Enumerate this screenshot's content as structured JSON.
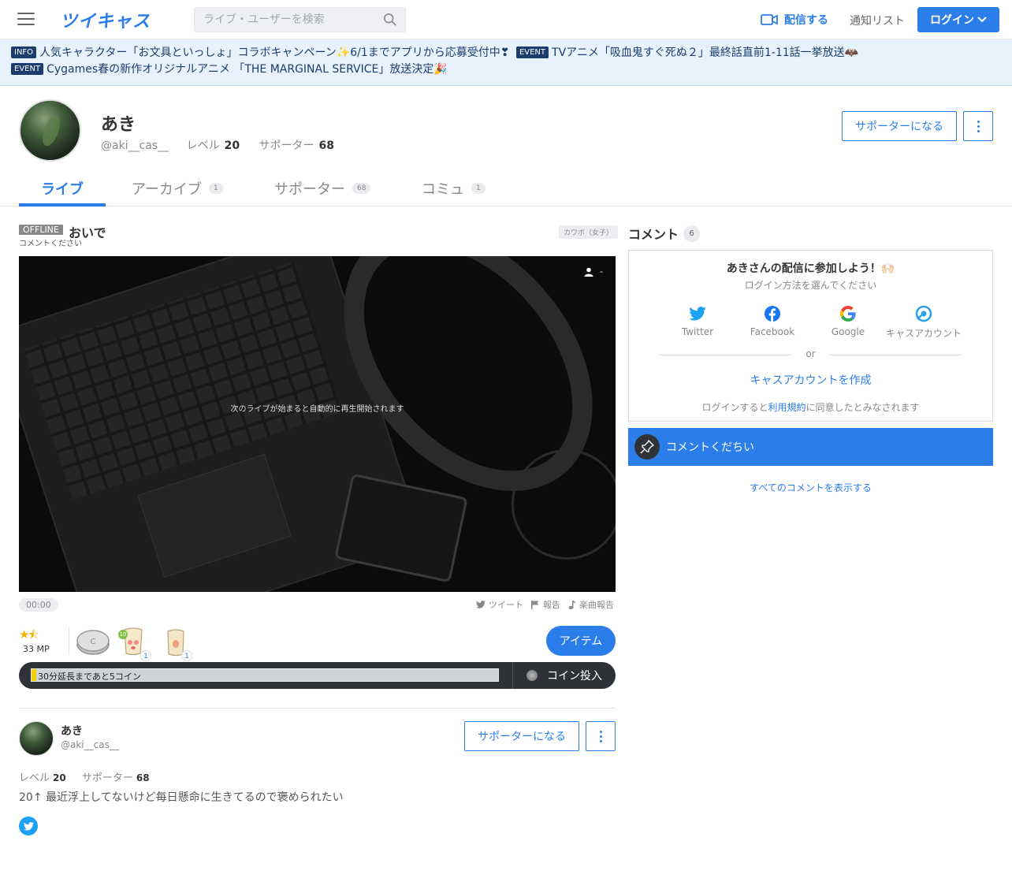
{
  "header": {
    "logo": "ツイキャス",
    "search_placeholder": "ライブ・ユーザーを検索",
    "broadcast_label": "配信する",
    "notify_label": "通知リスト",
    "login_label": "ログイン"
  },
  "infobar": {
    "items": [
      {
        "tag": "INFO",
        "text": "人気キャラクター「お文具といっしょ」コラボキャンペーン✨6/1までアプリから応募受付中❣"
      },
      {
        "tag": "EVENT",
        "text": "TVアニメ「吸血鬼すぐ死ぬ２」最終話直前1-11話一挙放送🦇"
      },
      {
        "tag": "EVENT",
        "text": "Cygames春の新作オリジナルアニメ 「THE MARGINAL SERVICE」放送決定🎉"
      }
    ]
  },
  "profile": {
    "name": "あき",
    "handle": "@aki__cas__",
    "level_label": "レベル",
    "level": "20",
    "supporter_label": "サポーター",
    "supporters": "68",
    "supporter_button": "サポーターになる"
  },
  "tabs": [
    {
      "label": "ライブ",
      "count": ""
    },
    {
      "label": "アーカイブ",
      "count": "1"
    },
    {
      "label": "サポーター",
      "count": "68"
    },
    {
      "label": "コミュ",
      "count": "1"
    }
  ],
  "stream": {
    "status": "OFFLINE",
    "title": "おいで",
    "subtitle": "コメントください",
    "category": "カワボ（女子）",
    "viewers": "-",
    "video_message": "次のライブが始まると自動的に再生開始されます",
    "time": "00:00",
    "tweet_label": "ツイート",
    "report_label": "報告",
    "music_report_label": "楽曲報告",
    "stars": "★⯪",
    "mp": "33 MP",
    "gift_count_1": "1",
    "gift_count_2": "1",
    "gift_level": "10",
    "item_button": "アイテム",
    "extend_label": "30分延長まであと5コイン",
    "extend_progress": 0.01,
    "coin_button": "コイン投入"
  },
  "card": {
    "name": "あき",
    "handle": "@aki__cas__",
    "level_label": "レベル",
    "level": "20",
    "supporter_label": "サポーター",
    "supporters": "68",
    "supporter_button": "サポーターになる",
    "bio": "20↑ 最近浮上してないけど毎日懸命に生きてるので褒められたい"
  },
  "comments": {
    "title": "コメント",
    "count": "6",
    "login_title": "あきさんの配信に参加しよう！🙌🏻",
    "login_sub": "ログイン方法を選んでください",
    "sns": [
      {
        "label": "Twitter"
      },
      {
        "label": "Facebook"
      },
      {
        "label": "Google"
      },
      {
        "label": "キャスアカウント"
      }
    ],
    "or": "or",
    "create_account": "キャスアカウントを作成",
    "terms_prefix": "ログインすると",
    "terms_link": "利用規約",
    "terms_suffix": "に同意したとみなされます",
    "pinned_comment": "コメントくだちい",
    "show_all": "すべてのコメントを表示する"
  },
  "colors": {
    "accent": "#2b7de9",
    "info_bg": "#e8f2fc",
    "dark": "#2e3237"
  }
}
